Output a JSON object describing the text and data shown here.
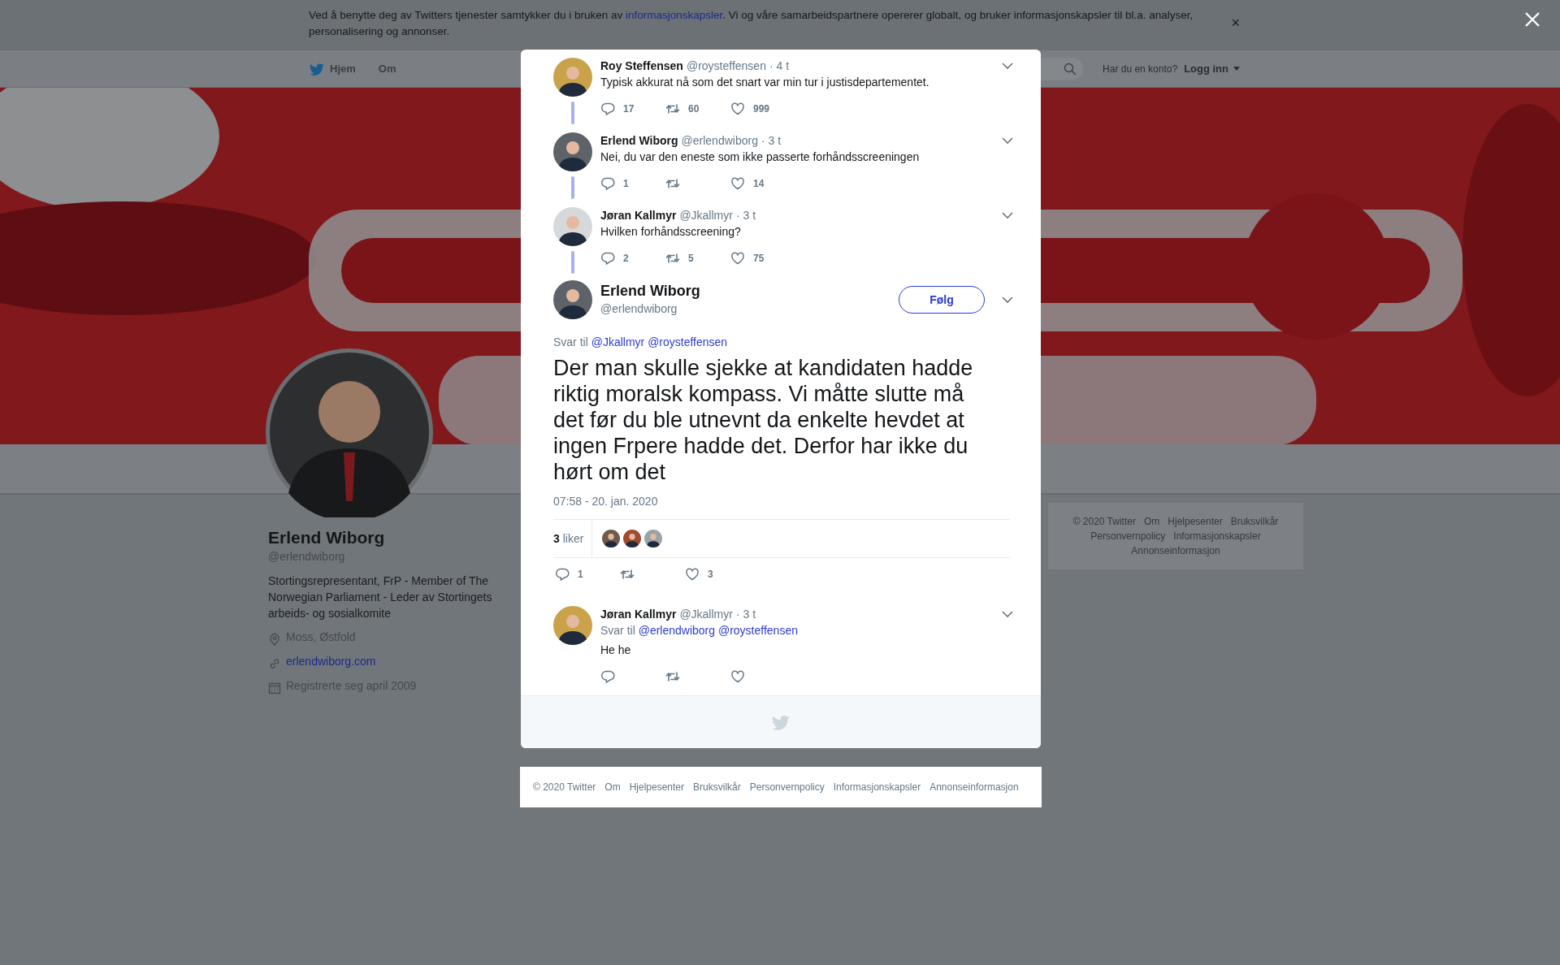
{
  "cookie_banner": {
    "text_before": "Ved å benytte deg av Twitters tjenester samtykker du i bruken av ",
    "link": "informasjonskapsler",
    "text_after": ". Vi og våre samarbeidspartnere opererer globalt, og bruker informasjonskapsler til bl.a. analyser, personalisering og annonser.",
    "dismiss": "×"
  },
  "nav": {
    "items": [
      {
        "label": "Hjem",
        "kind": "home"
      },
      {
        "label": "Om",
        "kind": "plain"
      }
    ],
    "account_prompt": "Har du en konto?",
    "login": "Logg inn"
  },
  "header_image": {
    "kind": "picture"
  },
  "profile": {
    "name": "Erlend Wiborg",
    "handle": "@erlendwiborg",
    "bio": "Stortingsrepresentant, FrP - Member of The Norwegian Parliament - Leder av Stortingets arbeids- og sosialkomite",
    "location": "Moss, Østfold",
    "website": "erlendwiborg.com",
    "joined": "Registrerte seg april 2009"
  },
  "side_footer": {
    "links": [
      "© 2020 Twitter",
      "Om",
      "Hjelpesenter",
      "Bruksvilkår",
      "Personvernpolicy",
      "Informasjonskapsler",
      "Annonseinformasjon"
    ]
  },
  "thread": {
    "tweets": [
      {
        "kind": "ancestor",
        "name": "Roy Steffensen",
        "handle": "@roysteffensen",
        "time": "· 4 t",
        "text": "Typisk akkurat nå som det snart var min tur i justisdepartementet.",
        "replies": "17",
        "retweets": "60",
        "likes": "999"
      },
      {
        "kind": "ancestor",
        "name": "Erlend Wiborg",
        "handle": "@erlendwiborg",
        "time": "· 3 t",
        "text": "Nei, du var den eneste som ikke passerte forhåndsscreeningen",
        "replies": "1",
        "likes": "14"
      },
      {
        "kind": "ancestor",
        "name": "Jøran Kallmyr",
        "handle": "@Jkallmyr",
        "time": "· 3 t",
        "text": "Hvilken forhåndsscreening?",
        "replies": "2",
        "retweets": "5",
        "likes": "75"
      },
      {
        "kind": "focus",
        "name": "Erlend Wiborg",
        "handle": "@erlendwiborg",
        "follow": "Følg",
        "reply_label": "Svar til",
        "reply_to": [
          "@Jkallmyr",
          "@roysteffensen"
        ],
        "text": "Der man skulle sjekke at kandidaten hadde riktig moralsk kompass. Vi måtte slutte må det før du ble utnevnt da enkelte hevdet at ingen Frpere hadde det. Derfor har ikke du hørt om det",
        "date": "07:58 - 20. jan. 2020",
        "like_summary": "**3** liker",
        "likers": [
          {
            "kind": "picture"
          },
          {
            "kind": "picture"
          },
          {
            "kind": "picture"
          }
        ],
        "replies": "1",
        "likes": "3"
      },
      {
        "kind": "reply",
        "name": "Jøran Kallmyr",
        "handle": "@Jkallmyr",
        "time": "· 3 t",
        "reply_label": "Svar til",
        "reply_to": [
          "@erlendwiborg",
          "@roysteffensen"
        ],
        "text": "He he"
      }
    ]
  },
  "modal_footer": {
    "links": [
      "© 2020 Twitter",
      "Om",
      "Hjelpesenter",
      "Bruksvilkår",
      "Personvernpolicy",
      "Informasjonskapsler",
      "Annonseinformasjon"
    ]
  }
}
